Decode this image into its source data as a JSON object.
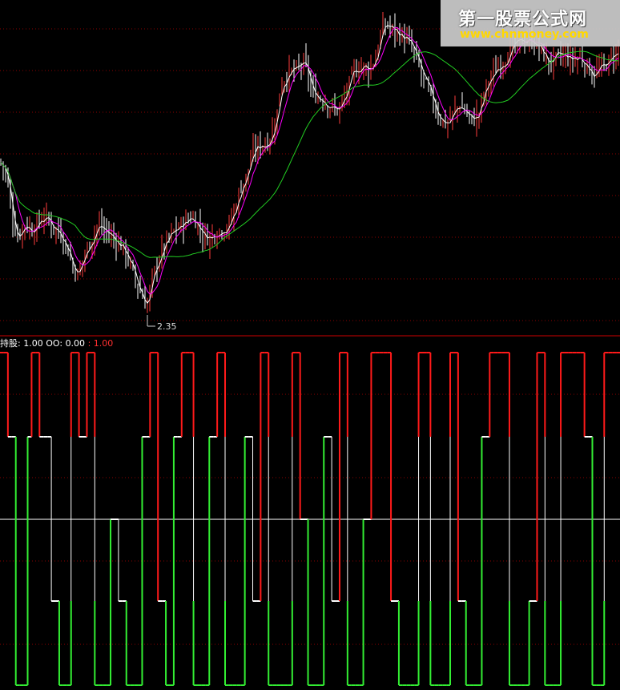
{
  "watermark": {
    "title": "第一股票公式网",
    "url": "www.chnmoney.com"
  },
  "indicator_legend": {
    "name1": "持股",
    "value1": "1.00",
    "name2": "OO",
    "value2": "0.00",
    "value3": "1.00"
  },
  "colors": {
    "background": "#000000",
    "grid": "#8b0000",
    "separator": "#cc0000",
    "candle_up": "#ff3c3c",
    "candle_down": "#ffffff",
    "ma_short": "#ffffff",
    "ma_mid": "#ff00ff",
    "ma_long": "#22cc22",
    "signal_high": "#ff1a1a",
    "signal_mid": "#ffffff",
    "signal_low": "#33ee33"
  },
  "chart_data": [
    {
      "type": "candlestick",
      "annotation": {
        "text": "2.35"
      },
      "price_path": [
        [
          0,
          3.4
        ],
        [
          8,
          3.3
        ],
        [
          15,
          3.0
        ],
        [
          22,
          2.85
        ],
        [
          30,
          2.95
        ],
        [
          40,
          2.9
        ],
        [
          55,
          3.0
        ],
        [
          68,
          2.92
        ],
        [
          78,
          2.86
        ],
        [
          85,
          2.75
        ],
        [
          92,
          2.62
        ],
        [
          97,
          2.58
        ],
        [
          105,
          2.72
        ],
        [
          113,
          2.82
        ],
        [
          122,
          2.94
        ],
        [
          130,
          2.9
        ],
        [
          140,
          2.85
        ],
        [
          150,
          2.8
        ],
        [
          160,
          2.7
        ],
        [
          168,
          2.55
        ],
        [
          176,
          2.45
        ],
        [
          183,
          2.35
        ],
        [
          190,
          2.55
        ],
        [
          198,
          2.7
        ],
        [
          208,
          2.82
        ],
        [
          218,
          2.9
        ],
        [
          228,
          2.94
        ],
        [
          238,
          3.0
        ],
        [
          245,
          2.96
        ],
        [
          252,
          2.88
        ],
        [
          260,
          2.84
        ],
        [
          268,
          2.88
        ],
        [
          276,
          2.91
        ],
        [
          285,
          2.92
        ],
        [
          293,
          3.05
        ],
        [
          300,
          3.2
        ],
        [
          307,
          3.28
        ],
        [
          315,
          3.45
        ],
        [
          322,
          3.5
        ],
        [
          330,
          3.52
        ],
        [
          337,
          3.56
        ],
        [
          345,
          3.7
        ],
        [
          350,
          3.95
        ],
        [
          360,
          4.02
        ],
        [
          370,
          4.05
        ],
        [
          380,
          4.1
        ],
        [
          390,
          3.88
        ],
        [
          400,
          3.85
        ],
        [
          410,
          3.8
        ],
        [
          420,
          3.75
        ],
        [
          430,
          3.84
        ],
        [
          440,
          4.02
        ],
        [
          450,
          4.08
        ],
        [
          460,
          4.05
        ],
        [
          468,
          4.12
        ],
        [
          475,
          4.3
        ],
        [
          482,
          4.38
        ],
        [
          490,
          4.34
        ],
        [
          500,
          4.3
        ],
        [
          510,
          4.25
        ],
        [
          520,
          4.12
        ],
        [
          530,
          3.96
        ],
        [
          540,
          3.82
        ],
        [
          550,
          3.7
        ],
        [
          558,
          3.66
        ],
        [
          566,
          3.74
        ],
        [
          574,
          3.8
        ],
        [
          582,
          3.74
        ],
        [
          590,
          3.68
        ],
        [
          598,
          3.74
        ],
        [
          606,
          3.92
        ],
        [
          614,
          4.0
        ],
        [
          622,
          4.08
        ],
        [
          632,
          4.14
        ],
        [
          642,
          4.22
        ],
        [
          652,
          4.26
        ],
        [
          660,
          4.28
        ],
        [
          668,
          4.24
        ],
        [
          676,
          4.18
        ],
        [
          684,
          4.1
        ],
        [
          692,
          4.12
        ],
        [
          700,
          4.15
        ],
        [
          708,
          4.14
        ],
        [
          716,
          4.12
        ],
        [
          724,
          4.14
        ],
        [
          732,
          4.08
        ],
        [
          740,
          4.02
        ],
        [
          748,
          4.05
        ],
        [
          756,
          4.08
        ],
        [
          764,
          4.14
        ],
        [
          774,
          4.2
        ]
      ]
    },
    {
      "type": "step-line",
      "levels": [
        "high",
        "mid-upper",
        "mid",
        "mid-lower",
        "low"
      ],
      "series": [
        {
          "values": [
            4,
            4,
            3,
            3,
            0,
            0,
            0,
            3,
            4,
            4,
            3,
            3,
            3,
            1,
            1,
            0,
            0,
            0,
            4,
            4,
            3,
            3,
            4,
            4,
            0,
            0,
            0,
            0,
            2,
            2,
            1,
            1,
            0,
            0,
            0,
            0,
            3,
            3,
            4,
            4,
            1,
            1,
            0,
            0,
            3,
            3,
            4,
            4,
            4,
            0,
            0,
            0,
            0,
            3,
            3,
            4,
            4,
            0,
            0,
            0,
            0,
            0,
            3,
            3,
            1,
            1,
            4,
            4,
            0,
            0,
            0,
            0,
            0,
            0,
            4,
            4,
            2,
            2,
            0,
            0,
            0,
            0,
            3,
            3,
            1,
            1,
            4,
            4,
            0,
            0,
            0,
            0,
            2,
            2,
            4,
            4,
            4,
            4,
            4,
            1,
            1,
            0,
            0,
            0,
            0,
            0,
            4,
            4,
            4,
            0,
            0,
            0,
            0,
            0,
            4,
            4,
            1,
            1,
            0,
            0,
            0,
            0,
            3,
            3,
            4,
            4,
            4,
            4,
            4,
            0,
            0,
            0,
            0,
            0,
            1,
            1,
            4,
            4,
            0,
            0,
            0,
            0,
            4,
            4,
            4,
            4,
            4,
            4,
            3,
            3,
            0,
            0,
            0,
            4,
            4,
            4,
            4
          ]
        }
      ]
    }
  ]
}
